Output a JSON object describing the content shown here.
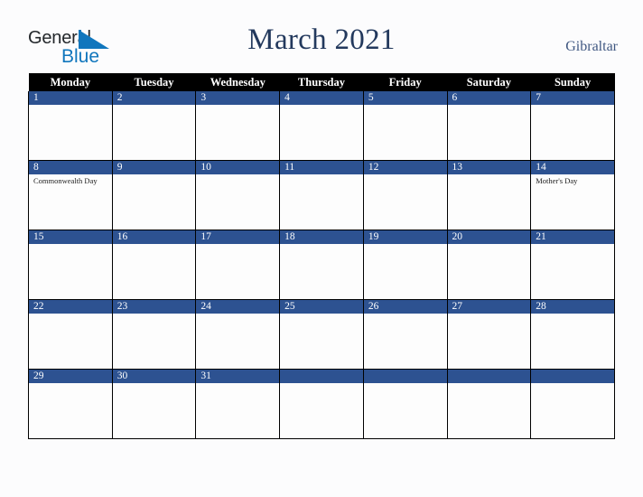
{
  "brand": {
    "name_top": "General",
    "name_bottom": "Blue",
    "triangle_color": "#1076bd",
    "top_text_color": "#23272b"
  },
  "header": {
    "title": "March 2021",
    "country": "Gibraltar",
    "title_color": "#23395d",
    "country_color": "#3f5781"
  },
  "calendar": {
    "month": "March",
    "year": "2021",
    "accent_color": "#2d5291",
    "header_bg_color": "#000000",
    "weekday_headers": [
      "Monday",
      "Tuesday",
      "Wednesday",
      "Thursday",
      "Friday",
      "Saturday",
      "Sunday"
    ],
    "weeks": [
      [
        {
          "day": "1",
          "event": ""
        },
        {
          "day": "2",
          "event": ""
        },
        {
          "day": "3",
          "event": ""
        },
        {
          "day": "4",
          "event": ""
        },
        {
          "day": "5",
          "event": ""
        },
        {
          "day": "6",
          "event": ""
        },
        {
          "day": "7",
          "event": ""
        }
      ],
      [
        {
          "day": "8",
          "event": "Commonwealth Day"
        },
        {
          "day": "9",
          "event": ""
        },
        {
          "day": "10",
          "event": ""
        },
        {
          "day": "11",
          "event": ""
        },
        {
          "day": "12",
          "event": ""
        },
        {
          "day": "13",
          "event": ""
        },
        {
          "day": "14",
          "event": "Mother's Day"
        }
      ],
      [
        {
          "day": "15",
          "event": ""
        },
        {
          "day": "16",
          "event": ""
        },
        {
          "day": "17",
          "event": ""
        },
        {
          "day": "18",
          "event": ""
        },
        {
          "day": "19",
          "event": ""
        },
        {
          "day": "20",
          "event": ""
        },
        {
          "day": "21",
          "event": ""
        }
      ],
      [
        {
          "day": "22",
          "event": ""
        },
        {
          "day": "23",
          "event": ""
        },
        {
          "day": "24",
          "event": ""
        },
        {
          "day": "25",
          "event": ""
        },
        {
          "day": "26",
          "event": ""
        },
        {
          "day": "27",
          "event": ""
        },
        {
          "day": "28",
          "event": ""
        }
      ],
      [
        {
          "day": "29",
          "event": ""
        },
        {
          "day": "30",
          "event": ""
        },
        {
          "day": "31",
          "event": ""
        },
        {
          "day": "",
          "event": ""
        },
        {
          "day": "",
          "event": ""
        },
        {
          "day": "",
          "event": ""
        },
        {
          "day": "",
          "event": ""
        }
      ]
    ]
  }
}
